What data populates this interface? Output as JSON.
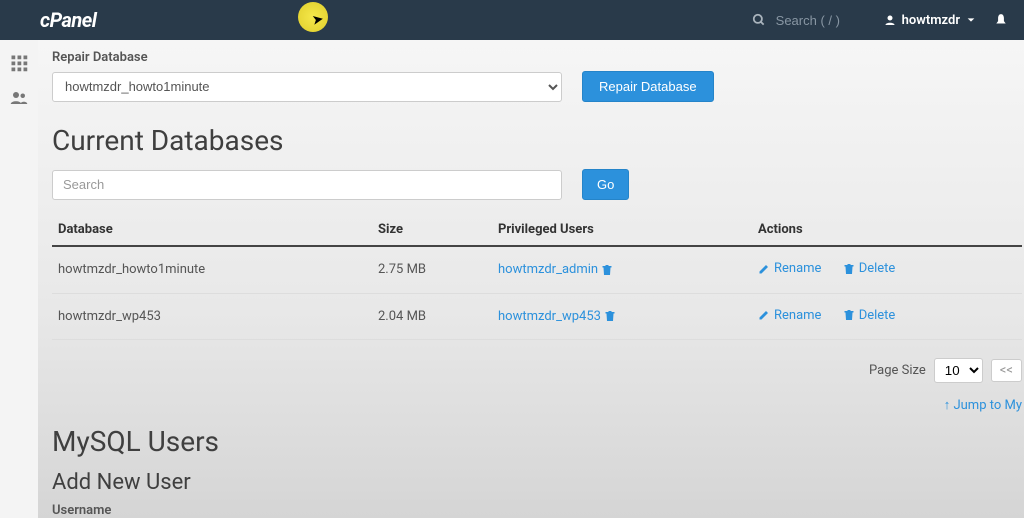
{
  "header": {
    "logo": "cPanel",
    "search_placeholder": "Search ( / )",
    "username": "howtmzdr"
  },
  "repair": {
    "label": "Repair Database",
    "selected": "howtmzdr_howto1minute",
    "button": "Repair Database"
  },
  "databases": {
    "title": "Current Databases",
    "search_placeholder": "Search",
    "go_label": "Go",
    "columns": {
      "database": "Database",
      "size": "Size",
      "users": "Privileged Users",
      "actions": "Actions"
    },
    "rows": [
      {
        "name": "howtmzdr_howto1minute",
        "size": "2.75 MB",
        "user": "howtmzdr_admin"
      },
      {
        "name": "howtmzdr_wp453",
        "size": "2.04 MB",
        "user": "howtmzdr_wp453"
      }
    ],
    "action_rename": "Rename",
    "action_delete": "Delete"
  },
  "pagination": {
    "label": "Page Size",
    "value": "10",
    "prev": "<<"
  },
  "jump_link": "Jump to My",
  "users_section": {
    "title": "MySQL Users",
    "subtitle": "Add New User",
    "field_username": "Username"
  }
}
